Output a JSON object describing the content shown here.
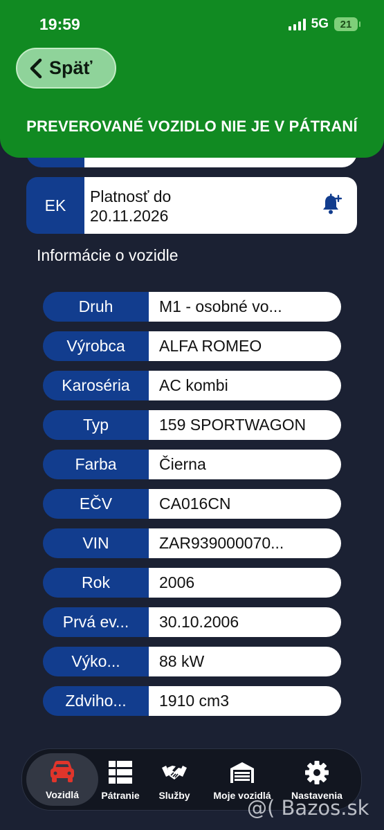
{
  "status_bar": {
    "time": "19:59",
    "network": "5G",
    "battery": "21"
  },
  "header": {
    "back_label": "Späť",
    "banner": "PREVEROVANÉ VOZIDLO NIE JE V PÁTRANÍ"
  },
  "ek": {
    "label": "EK",
    "line1": "Platnosť do",
    "line2": "20.11.2026"
  },
  "section_title": "Informácie o vozidle",
  "vehicle_info": [
    {
      "key": "Druh",
      "value": "M1 - osobné vo..."
    },
    {
      "key": "Výrobca",
      "value": "ALFA ROMEO"
    },
    {
      "key": "Karoséria",
      "value": "AC kombi"
    },
    {
      "key": "Typ",
      "value": "159 SPORTWAGON"
    },
    {
      "key": "Farba",
      "value": "Čierna"
    },
    {
      "key": "EČV",
      "value": "CA016CN"
    },
    {
      "key": "VIN",
      "value": "ZAR939000070..."
    },
    {
      "key": "Rok",
      "value": "2006"
    },
    {
      "key": "Prvá ev...",
      "value": "30.10.2006"
    },
    {
      "key": "Výko...",
      "value": "88 kW"
    },
    {
      "key": "Zdviho...",
      "value": "1910 cm3"
    }
  ],
  "tabbar": {
    "tabs": [
      {
        "label": "Vozidlá",
        "icon": "car-icon",
        "active": true
      },
      {
        "label": "Pátranie",
        "icon": "list-icon"
      },
      {
        "label": "Služby",
        "icon": "handshake-icon"
      },
      {
        "label": "Moje vozidlá",
        "icon": "garage-icon"
      },
      {
        "label": "Nastavenia",
        "icon": "gear-icon"
      }
    ]
  },
  "watermark": "@( Bazos.sk",
  "colors": {
    "header_green": "#118a22",
    "label_blue": "#123d8e",
    "background": "#1b2133",
    "active_car_red": "#e0352b"
  }
}
